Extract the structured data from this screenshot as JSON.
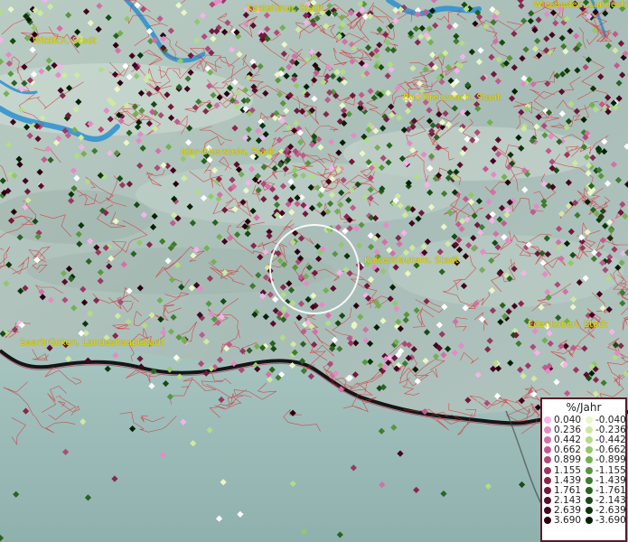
{
  "map": {
    "cities": [
      {
        "name": "Kastellaun, Stadt",
        "pos": [
          273,
          4
        ]
      },
      {
        "name": "Wiesbaden, Landeshauptstadt",
        "pos": [
          590,
          0
        ]
      },
      {
        "name": "Wittlich, Stadt",
        "pos": [
          36,
          40
        ]
      },
      {
        "name": "Bad Kreuznach, Stadt",
        "pos": [
          446,
          103
        ]
      },
      {
        "name": "Idar-Oberstein, Stadt",
        "pos": [
          200,
          163
        ]
      },
      {
        "name": "Kaiserslautern, Stadt",
        "pos": [
          403,
          283
        ]
      },
      {
        "name": "Edenkoben, Stadt",
        "pos": [
          584,
          354
        ]
      },
      {
        "name": "Saarbrücken, Landeshauptstadt",
        "pos": [
          22,
          374
        ]
      }
    ]
  },
  "legend": {
    "title": "%/Jahr",
    "positive": [
      {
        "label": "0.040",
        "color": "#f5b3e8"
      },
      {
        "label": "0.236",
        "color": "#e68ac6"
      },
      {
        "label": "0.442",
        "color": "#d46fa8"
      },
      {
        "label": "0.662",
        "color": "#c25a8e"
      },
      {
        "label": "0.899",
        "color": "#b04a78"
      },
      {
        "label": "1.155",
        "color": "#9a3862"
      },
      {
        "label": "1.439",
        "color": "#86284e"
      },
      {
        "label": "1.761",
        "color": "#701a3c"
      },
      {
        "label": "2.143",
        "color": "#5a0e2c"
      },
      {
        "label": "2.639",
        "color": "#42061e"
      },
      {
        "label": "3.690",
        "color": "#2a0010"
      }
    ],
    "negative": [
      {
        "label": "-0.040",
        "color": "#eaf7c4"
      },
      {
        "label": "-0.236",
        "color": "#cfeaa0"
      },
      {
        "label": "-0.442",
        "color": "#b2dc86"
      },
      {
        "label": "-0.662",
        "color": "#92c86a"
      },
      {
        "label": "-0.899",
        "color": "#74b052"
      },
      {
        "label": "-1.155",
        "color": "#58963e"
      },
      {
        "label": "-1.439",
        "color": "#3e7c2e"
      },
      {
        "label": "-1.761",
        "color": "#286420"
      },
      {
        "label": "-2.143",
        "color": "#164c14"
      },
      {
        "label": "-2.639",
        "color": "#0a360a"
      },
      {
        "label": "-3.690",
        "color": "#032203"
      }
    ]
  }
}
